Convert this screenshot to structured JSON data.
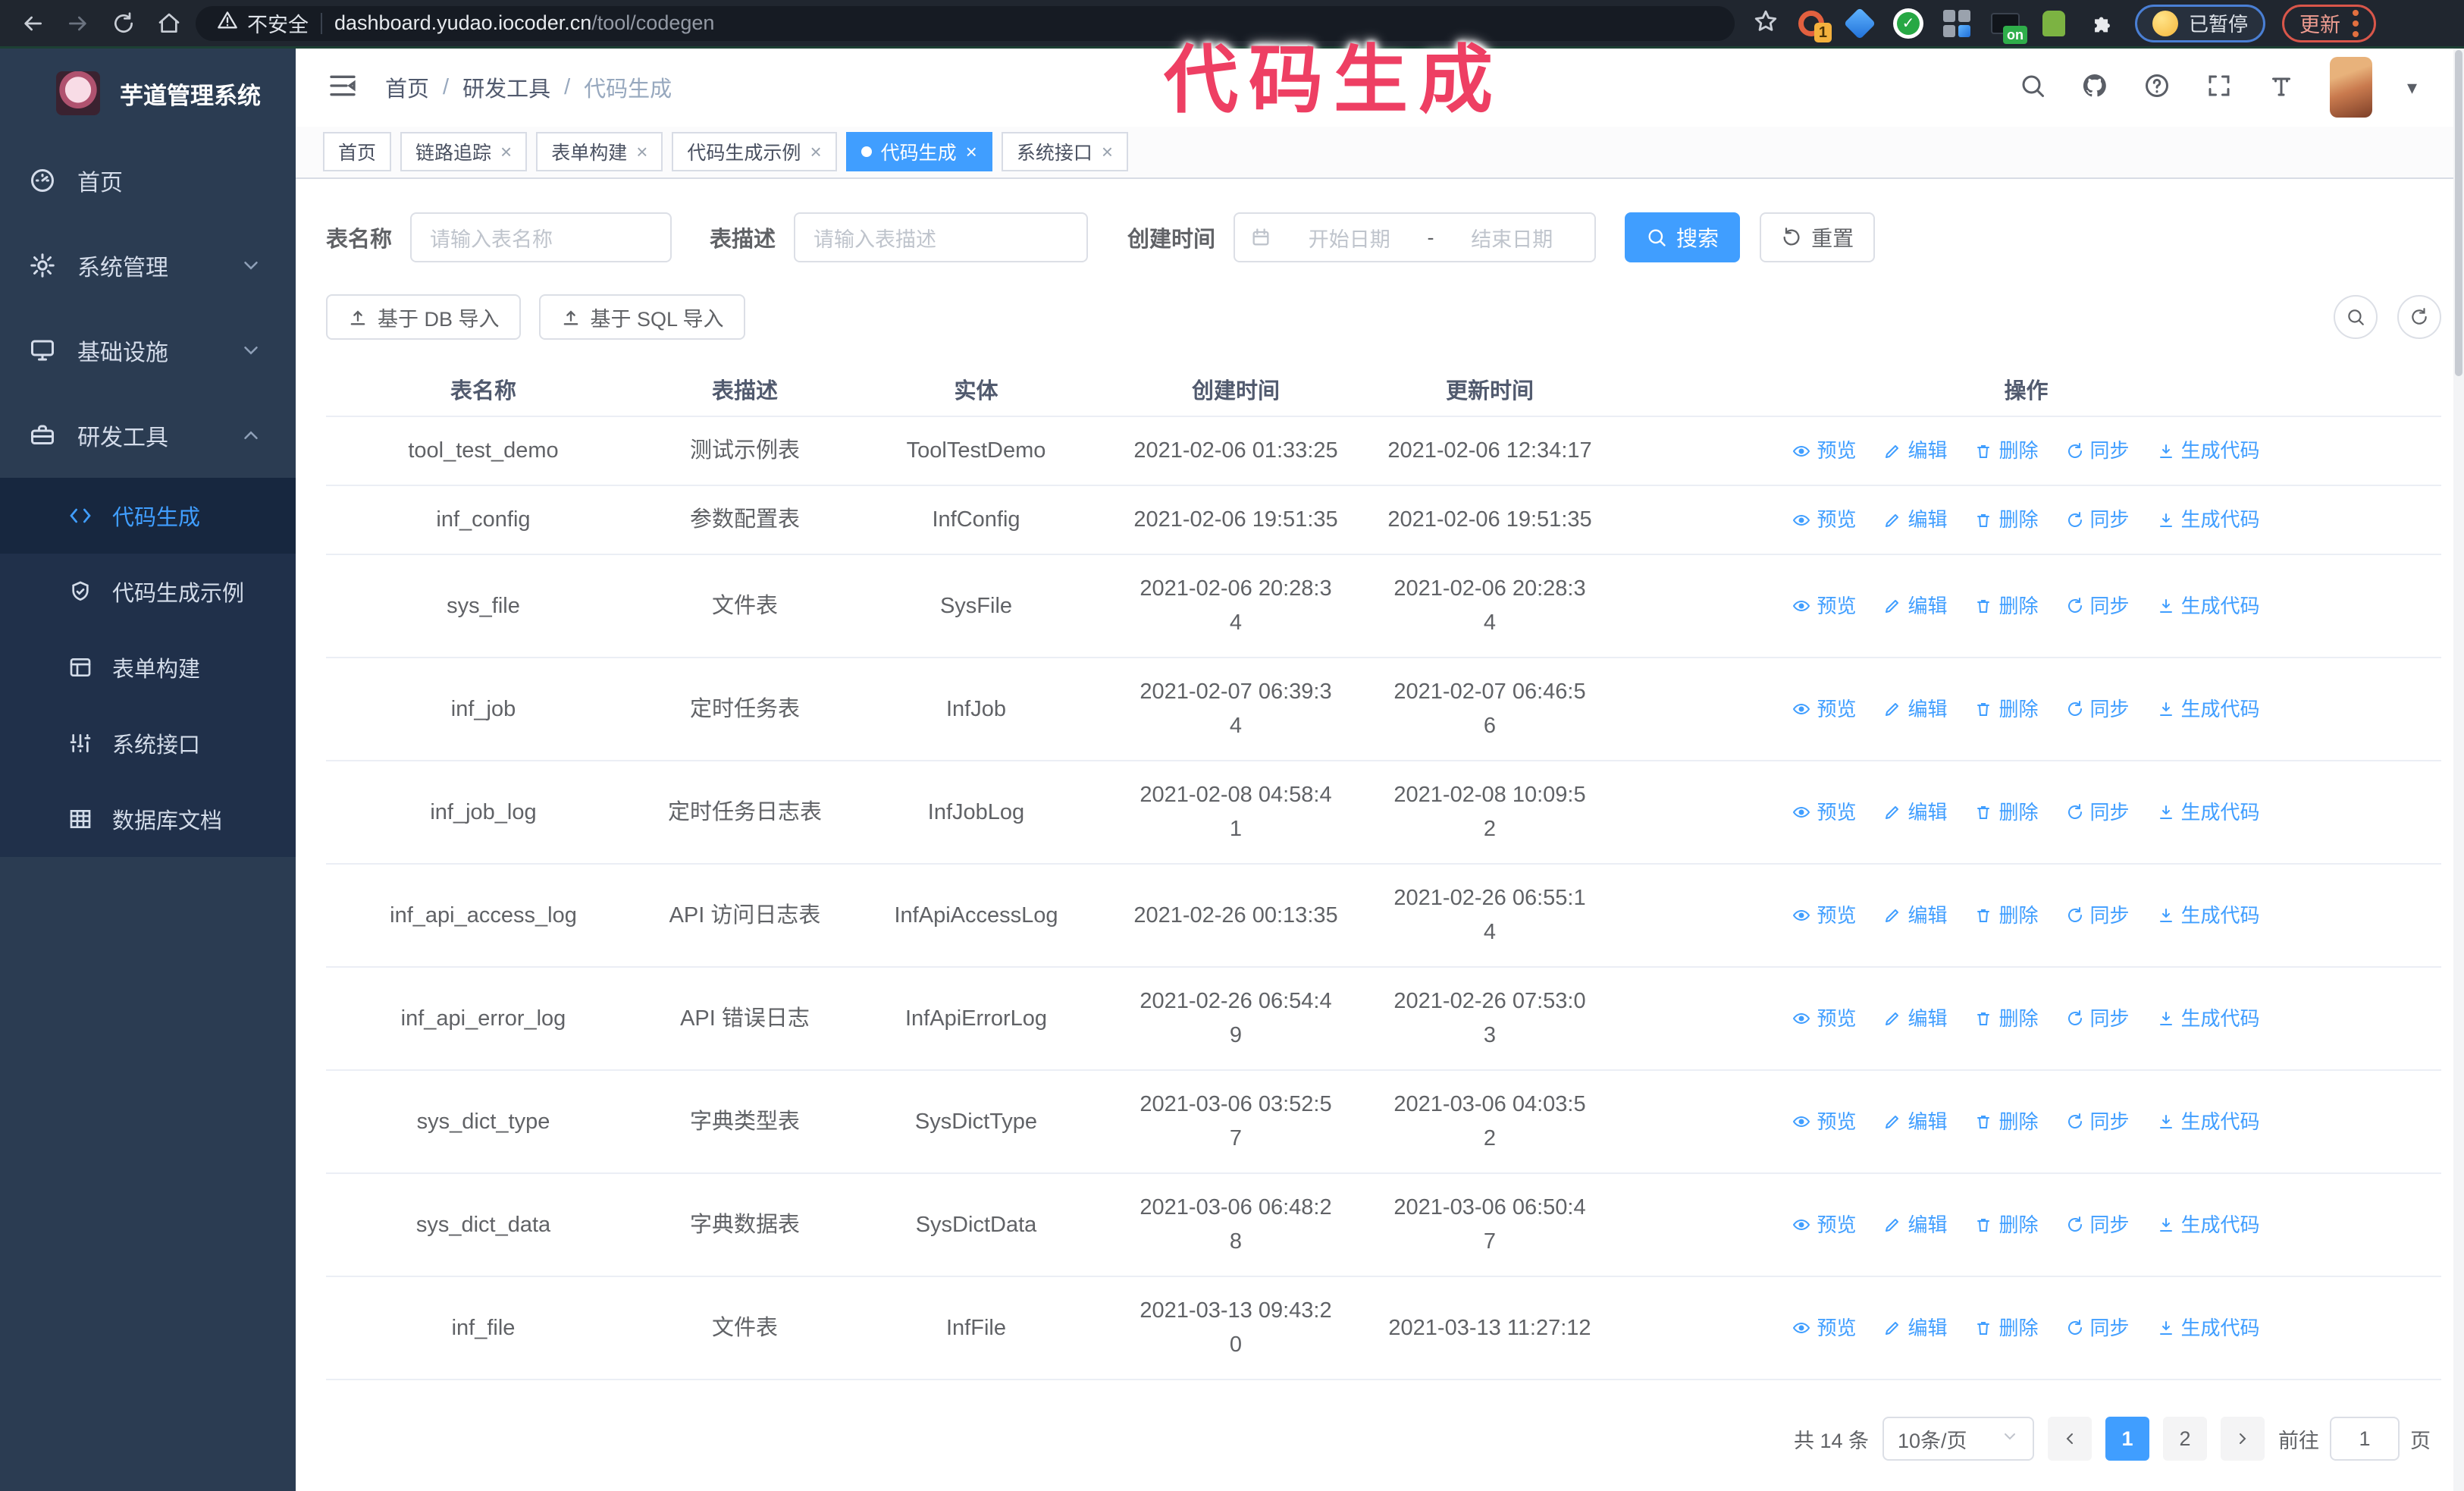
{
  "browser": {
    "security_label": "不安全",
    "url_host": "dashboard.yudao.iocoder.cn",
    "url_path": "/tool/codegen",
    "extension_badge": "1",
    "extension_on_badge": "on",
    "paused_badge": "已暂停",
    "update_button": "更新"
  },
  "annotation": {
    "text": "代码生成",
    "color": "#ee3f63"
  },
  "colors": {
    "primary": "#409eff",
    "sidebar_bg": "#2b3c52",
    "submenu_bg": "#20304a"
  },
  "sidebar": {
    "app_title": "芋道管理系统",
    "items": [
      {
        "label": "首页",
        "icon": "dashboard-icon",
        "chevron": ""
      },
      {
        "label": "系统管理",
        "icon": "gear-icon",
        "chevron": "down"
      },
      {
        "label": "基础设施",
        "icon": "infra-icon",
        "chevron": "down"
      },
      {
        "label": "研发工具",
        "icon": "tools-icon",
        "chevron": "up"
      }
    ],
    "subitems": [
      {
        "label": "代码生成",
        "icon": "code-icon",
        "active": true
      },
      {
        "label": "代码生成示例",
        "icon": "example-icon",
        "active": false
      },
      {
        "label": "表单构建",
        "icon": "form-icon",
        "active": false
      },
      {
        "label": "系统接口",
        "icon": "api-icon",
        "active": false
      },
      {
        "label": "数据库文档",
        "icon": "dbdoc-icon",
        "active": false
      }
    ]
  },
  "breadcrumb": [
    "首页",
    "研发工具",
    "代码生成"
  ],
  "tabs": [
    {
      "label": "首页",
      "closable": false,
      "active": false
    },
    {
      "label": "链路追踪",
      "closable": true,
      "active": false
    },
    {
      "label": "表单构建",
      "closable": true,
      "active": false
    },
    {
      "label": "代码生成示例",
      "closable": true,
      "active": false
    },
    {
      "label": "代码生成",
      "closable": true,
      "active": true
    },
    {
      "label": "系统接口",
      "closable": true,
      "active": false
    }
  ],
  "search_form": {
    "table_name_label": "表名称",
    "table_name_placeholder": "请输入表名称",
    "table_desc_label": "表描述",
    "table_desc_placeholder": "请输入表描述",
    "create_time_label": "创建时间",
    "date_start_placeholder": "开始日期",
    "date_separator": "-",
    "date_end_placeholder": "结束日期",
    "search_button": "搜索",
    "reset_button": "重置"
  },
  "toolbar": {
    "import_db_button": "基于 DB 导入",
    "import_sql_button": "基于 SQL 导入"
  },
  "table": {
    "columns": [
      "表名称",
      "表描述",
      "实体",
      "创建时间",
      "更新时间",
      "操作"
    ],
    "actions": [
      "预览",
      "编辑",
      "删除",
      "同步",
      "生成代码"
    ],
    "rows": [
      {
        "name": "tool_test_demo",
        "desc": "测试示例表",
        "entity": "ToolTestDemo",
        "created": "2021-02-06 01:33:25",
        "updated": "2021-02-06 12:34:17"
      },
      {
        "name": "inf_config",
        "desc": "参数配置表",
        "entity": "InfConfig",
        "created": "2021-02-06 19:51:35",
        "updated": "2021-02-06 19:51:35"
      },
      {
        "name": "sys_file",
        "desc": "文件表",
        "entity": "SysFile",
        "created": "2021-02-06 20:28:3\n4",
        "updated": "2021-02-06 20:28:3\n4"
      },
      {
        "name": "inf_job",
        "desc": "定时任务表",
        "entity": "InfJob",
        "created": "2021-02-07 06:39:3\n4",
        "updated": "2021-02-07 06:46:5\n6"
      },
      {
        "name": "inf_job_log",
        "desc": "定时任务日志表",
        "entity": "InfJobLog",
        "created": "2021-02-08 04:58:4\n1",
        "updated": "2021-02-08 10:09:5\n2"
      },
      {
        "name": "inf_api_access_log",
        "desc": "API 访问日志表",
        "entity": "InfApiAccessLog",
        "created": "2021-02-26 00:13:35",
        "updated": "2021-02-26 06:55:1\n4"
      },
      {
        "name": "inf_api_error_log",
        "desc": "API 错误日志",
        "entity": "InfApiErrorLog",
        "created": "2021-02-26 06:54:4\n9",
        "updated": "2021-02-26 07:53:0\n3"
      },
      {
        "name": "sys_dict_type",
        "desc": "字典类型表",
        "entity": "SysDictType",
        "created": "2021-03-06 03:52:5\n7",
        "updated": "2021-03-06 04:03:5\n2"
      },
      {
        "name": "sys_dict_data",
        "desc": "字典数据表",
        "entity": "SysDictData",
        "created": "2021-03-06 06:48:2\n8",
        "updated": "2021-03-06 06:50:4\n7"
      },
      {
        "name": "inf_file",
        "desc": "文件表",
        "entity": "InfFile",
        "created": "2021-03-13 09:43:2\n0",
        "updated": "2021-03-13 11:27:12"
      }
    ]
  },
  "pagination": {
    "total": "共 14 条",
    "page_size": "10条/页",
    "pages": [
      "1",
      "2"
    ],
    "active_page": "1",
    "jump_prefix": "前往",
    "jump_value": "1",
    "jump_suffix": "页"
  }
}
